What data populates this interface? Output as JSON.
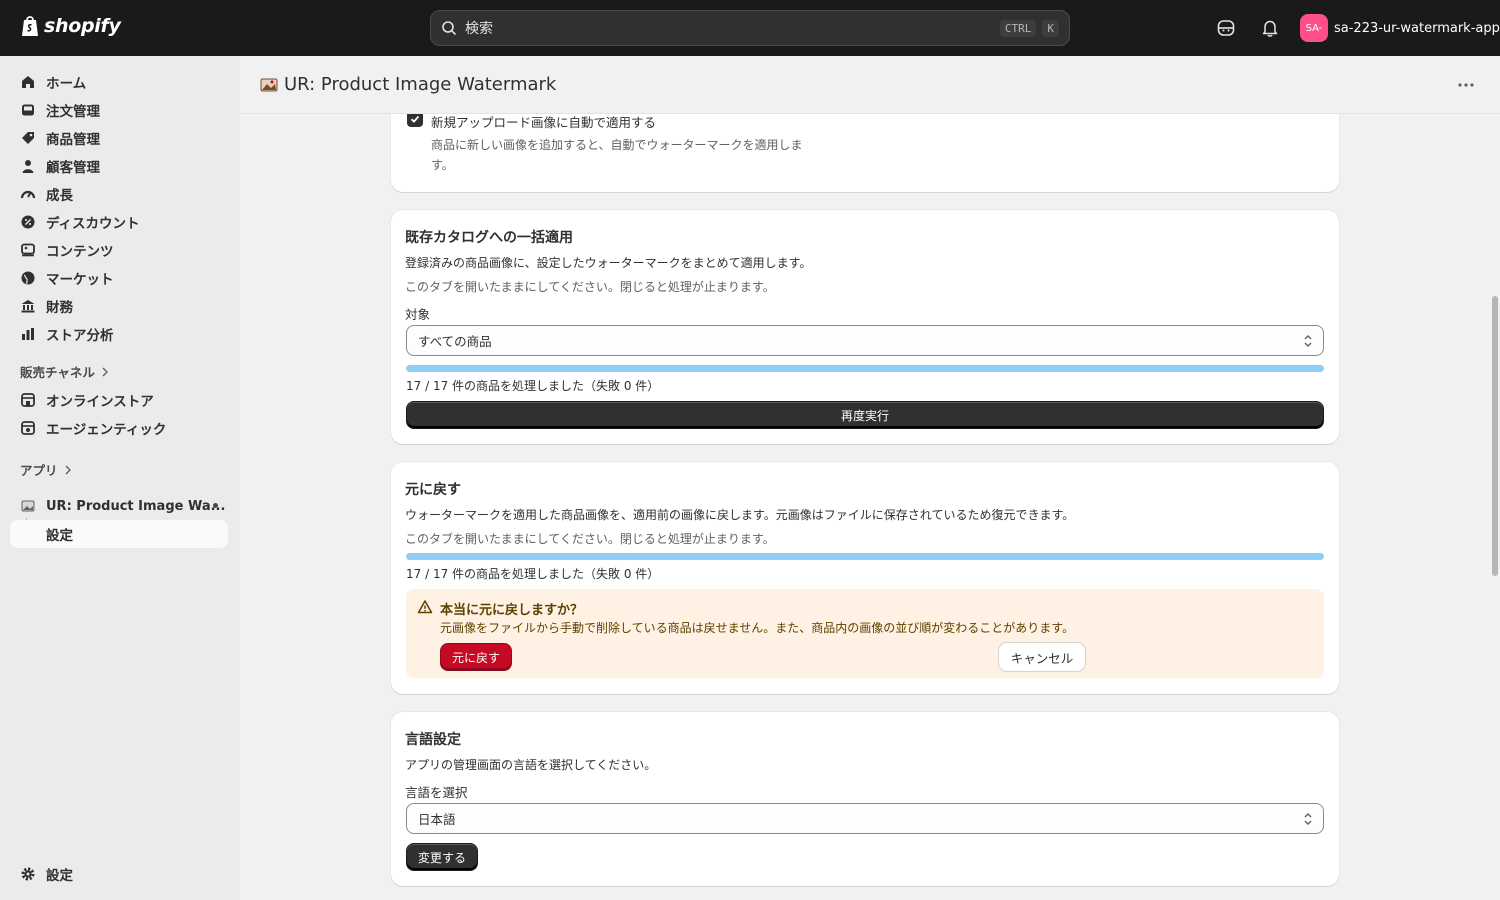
{
  "topbar": {
    "logo_text": "shopify",
    "search_placeholder": "検索",
    "shortcut_keys": [
      "CTRL",
      "K"
    ],
    "account_initials": "SA-",
    "account_name": "sa-223-ur-watermark-app"
  },
  "sidebar": {
    "items": [
      {
        "label": "ホーム",
        "icon": "home-icon"
      },
      {
        "label": "注文管理",
        "icon": "inbox-icon"
      },
      {
        "label": "商品管理",
        "icon": "tag-icon"
      },
      {
        "label": "顧客管理",
        "icon": "person-icon"
      },
      {
        "label": "成長",
        "icon": "gauge-icon"
      },
      {
        "label": "ディスカウント",
        "icon": "discount-icon"
      },
      {
        "label": "コンテンツ",
        "icon": "content-icon"
      },
      {
        "label": "マーケット",
        "icon": "globe-icon"
      },
      {
        "label": "財務",
        "icon": "bank-icon"
      },
      {
        "label": "ストア分析",
        "icon": "chart-icon"
      }
    ],
    "sales_channels_label": "販売チャネル",
    "channels": [
      {
        "label": "オンラインストア",
        "icon": "store-icon"
      },
      {
        "label": "エージェンティック",
        "icon": "agent-icon"
      }
    ],
    "apps_label": "アプリ",
    "app_name": "UR: Product Image Wa...",
    "app_sub_item": "設定",
    "settings_label": "設定"
  },
  "header": {
    "app_title": "UR: Product Image Watermark"
  },
  "auto_apply_card": {
    "checkbox_label": "新規アップロード画像に自動で適用する",
    "help_line1": "商品に新しい画像を追加すると、自動でウォーターマークを適用しま",
    "help_line2": "す。",
    "checked": true
  },
  "bulk_card": {
    "title": "既存カタログへの一括適用",
    "description": "登録済みの商品画像に、設定したウォーターマークをまとめて適用します。",
    "note": "このタブを開いたままにしてください。閉じると処理が止まります。",
    "target_label": "対象",
    "target_value": "すべての商品",
    "progress": 1.0,
    "status": "17 / 17 件の商品を処理しました（失敗 0 件）",
    "rerun_button": "再度実行"
  },
  "revert_card": {
    "title": "元に戻す",
    "description": "ウォーターマークを適用した商品画像を、適用前の画像に戻します。元画像はファイルに保存されているため復元できます。",
    "note": "このタブを開いたままにしてください。閉じると処理が止まります。",
    "progress": 1.0,
    "status": "17 / 17 件の商品を処理しました（失敗 0 件）",
    "warning_title": "本当に元に戻しますか？",
    "warning_text": "元画像をファイルから手動で削除している商品は戻せません。また、商品内の画像の並び順が変わることがあります。",
    "confirm_button": "元に戻す",
    "cancel_button": "キャンセル"
  },
  "language_card": {
    "title": "言語設定",
    "description": "アプリの管理画面の言語を選択してください。",
    "select_label": "言語を選択",
    "select_value": "日本語",
    "change_button": "変更する"
  },
  "colors": {
    "topbar": "#1a1a1a",
    "progress_fill": "#8fcdf5",
    "danger": "#c70a24",
    "warning_bg": "#fff1e3",
    "avatar": "#ff4f8b"
  }
}
